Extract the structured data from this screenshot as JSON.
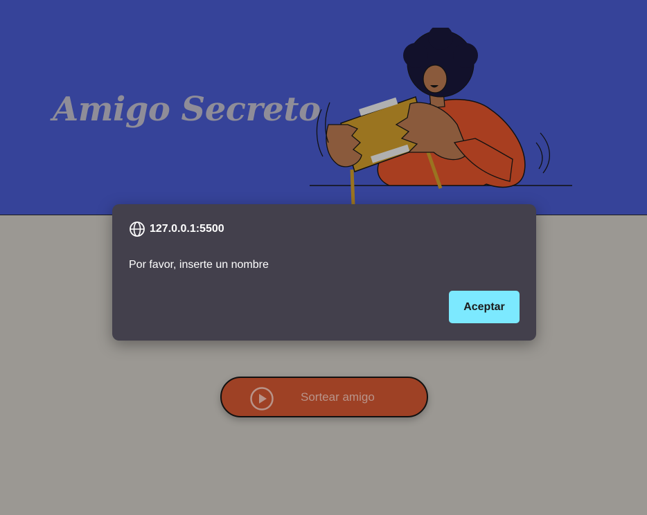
{
  "header": {
    "title": "Amigo Secreto"
  },
  "dialog": {
    "origin": "127.0.0.1:5500",
    "message": "Por favor, inserte un nombre",
    "accept_label": "Aceptar"
  },
  "actions": {
    "draw_label": "Sortear amigo",
    "draw_icon": "play-circle-icon"
  },
  "colors": {
    "header_bg": "#364399",
    "page_bg": "#9b9893",
    "dialog_bg": "#43404c",
    "accept_bg": "#7ce9ff",
    "draw_bg": "#9e4125"
  }
}
